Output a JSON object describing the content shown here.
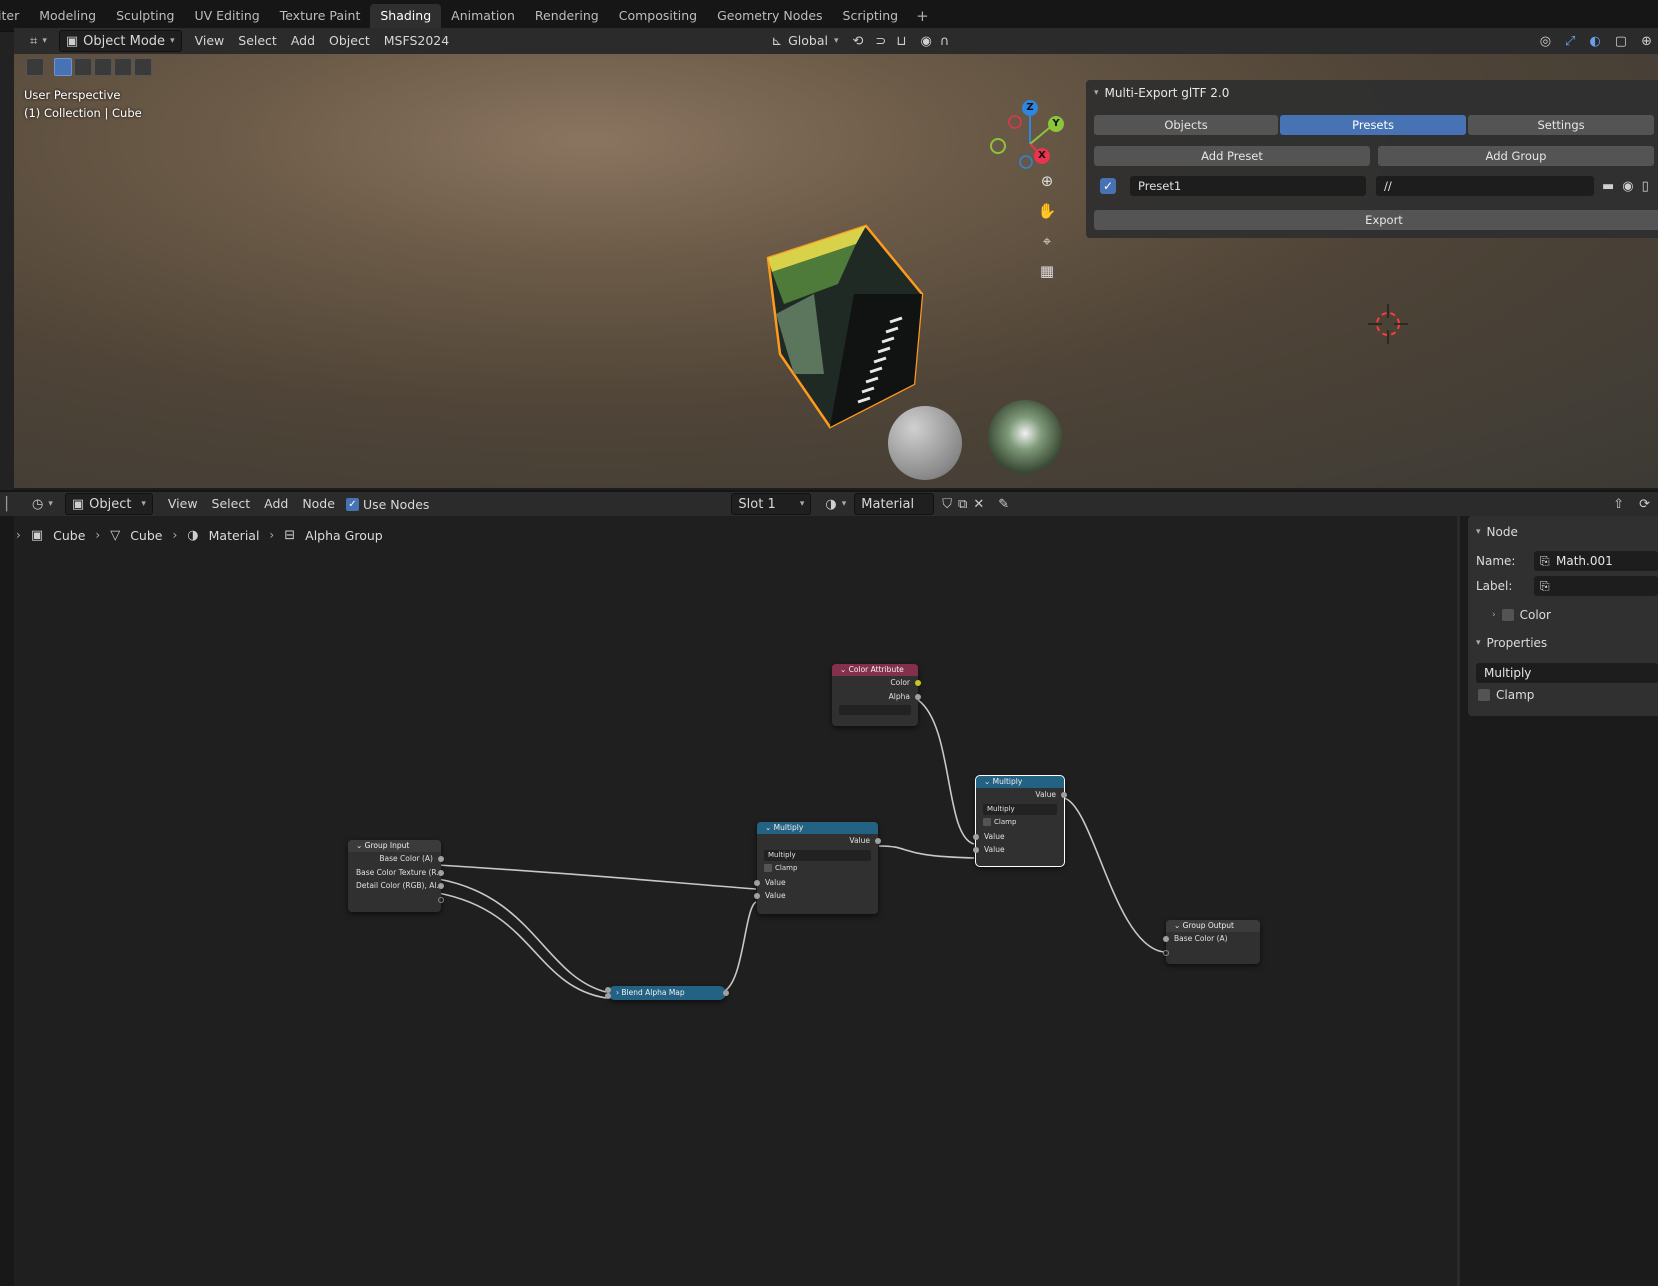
{
  "workspace_tabs": {
    "items": [
      "iter",
      "Modeling",
      "Sculpting",
      "UV Editing",
      "Texture Paint",
      "Shading",
      "Animation",
      "Rendering",
      "Compositing",
      "Geometry Nodes",
      "Scripting"
    ],
    "active": "Shading",
    "add_symbol": "+"
  },
  "viewport_header": {
    "mode_label": "Object Mode",
    "menu": [
      "View",
      "Select",
      "Add",
      "Object",
      "MSFS2024"
    ],
    "transform_orientation": "Global"
  },
  "viewport": {
    "perspective_label": "User Perspective",
    "collection_label": "(1) Collection | Cube",
    "gizmo_axes": {
      "x": "X",
      "y": "Y",
      "z": "Z"
    }
  },
  "export_panel": {
    "title": "Multi-Export glTF 2.0",
    "tabs": [
      "Objects",
      "Presets",
      "Settings"
    ],
    "active_tab": "Presets",
    "add_preset_label": "Add Preset",
    "add_group_label": "Add Group",
    "preset_name": "Preset1",
    "preset_path": "//",
    "preset_enabled": true,
    "export_label": "Export"
  },
  "node_editor_header": {
    "type_label": "Object",
    "menu": [
      "View",
      "Select",
      "Add",
      "Node"
    ],
    "use_nodes_label": "Use Nodes",
    "use_nodes_checked": true,
    "slot_label": "Slot 1",
    "material_name": "Material"
  },
  "breadcrumbs": [
    "Cube",
    "Cube",
    "Material",
    "Alpha Group"
  ],
  "nodes": {
    "color_attribute": {
      "title": "Color Attribute",
      "outputs": [
        "Color",
        "Alpha"
      ]
    },
    "group_input": {
      "title": "Group Input",
      "outputs": [
        "Base Color (A)",
        "Base Color Texture (R...",
        "Detail Color (RGB), Al..."
      ]
    },
    "multiply_1": {
      "title": "Multiply",
      "output": "Value",
      "operation": "Multiply",
      "clamp_label": "Clamp",
      "inputs": [
        "Value",
        "Value"
      ]
    },
    "multiply_2": {
      "title": "Multiply",
      "output": "Value",
      "operation": "Multiply",
      "clamp_label": "Clamp",
      "inputs": [
        "Value",
        "Value"
      ]
    },
    "blend_alpha_map": {
      "title": "Blend Alpha Map"
    },
    "group_output": {
      "title": "Group Output",
      "inputs": [
        "Base Color (A)"
      ]
    }
  },
  "side_panel": {
    "node_section_title": "Node",
    "name_label": "Name:",
    "name_value": "Math.001",
    "label_label": "Label:",
    "label_value": "",
    "color_label": "Color",
    "properties_title": "Properties",
    "operation": "Multiply",
    "clamp_label": "Clamp"
  },
  "colors": {
    "accent": "#4772b3",
    "math_header": "#246283",
    "attribute_header": "#83314a",
    "selection_outline": "#ff9a1f",
    "gizmo_x": "#e8344f",
    "gizmo_y": "#8bc53b",
    "gizmo_z": "#2e86de"
  }
}
